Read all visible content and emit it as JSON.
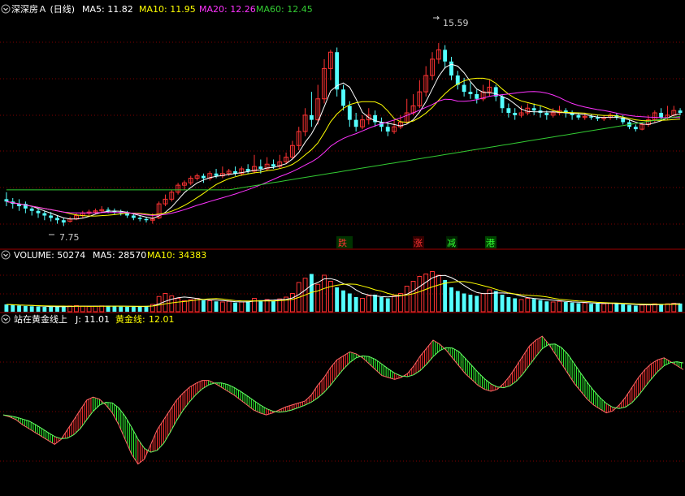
{
  "header": {
    "title": "深深房Ａ (日线)",
    "ma": [
      {
        "label": "MA5: 11.82",
        "color": "#ffffff"
      },
      {
        "label": "MA10: 11.95",
        "color": "#ffff00"
      },
      {
        "label": "MA20: 12.26",
        "color": "#ff33ff"
      },
      {
        "label": "MA60: 12.45",
        "color": "#33cc33"
      }
    ]
  },
  "volume_header": {
    "items": [
      {
        "label": "VOLUME: 50274",
        "color": "#ffffff"
      },
      {
        "label": "MA5: 28570",
        "color": "#ffffff"
      },
      {
        "label": "MA10: 34383",
        "color": "#ffff00"
      }
    ]
  },
  "indicator_header": {
    "items": [
      {
        "label": "站在黄金线上",
        "color": "#ffffff"
      },
      {
        "label": "J: 11.01",
        "color": "#ffffff"
      },
      {
        "label": "黄金线: ",
        "color": "#ffff00"
      },
      {
        "label": "12.01",
        "color": "#ffff00"
      }
    ]
  },
  "annotations": {
    "high_label": "15.59",
    "low_label": "7.75",
    "markers": [
      {
        "text": "跌",
        "color": "#ff3333"
      },
      {
        "text": "涨",
        "color": "#ff3333"
      },
      {
        "text": "减",
        "color": "#33ff33"
      },
      {
        "text": "港",
        "color": "#33ff33"
      }
    ]
  },
  "colors": {
    "up": "#ff3333",
    "down": "#54ffff",
    "ind_up": "#ff3333",
    "ind_down": "#33ff33",
    "grid": "#800000",
    "panel_border": "#a00000"
  },
  "chart_data": [
    {
      "type": "candlestick",
      "title": "深深房Ａ (日线)",
      "ylim": [
        7.0,
        16.6
      ],
      "high": 15.59,
      "low": 7.75,
      "moving_averages": [
        {
          "name": "MA5",
          "value": 11.82
        },
        {
          "name": "MA10",
          "value": 11.95
        },
        {
          "name": "MA20",
          "value": 12.26
        },
        {
          "name": "MA60",
          "value": 12.45
        }
      ],
      "candles": [
        [
          8.9,
          8.8,
          9.2,
          8.6
        ],
        [
          8.8,
          8.7,
          8.95,
          8.5
        ],
        [
          8.7,
          8.6,
          8.9,
          8.4
        ],
        [
          8.7,
          8.5,
          8.8,
          8.3
        ],
        [
          8.5,
          8.4,
          8.6,
          8.2
        ],
        [
          8.4,
          8.3,
          8.5,
          8.1
        ],
        [
          8.3,
          8.2,
          8.4,
          8.0
        ],
        [
          8.2,
          8.1,
          8.35,
          7.95
        ],
        [
          8.1,
          8.0,
          8.2,
          7.85
        ],
        [
          8.0,
          7.9,
          8.1,
          7.75
        ],
        [
          7.95,
          8.05,
          8.15,
          7.9
        ],
        [
          8.05,
          8.2,
          8.3,
          8.0
        ],
        [
          8.2,
          8.3,
          8.4,
          8.1
        ],
        [
          8.3,
          8.35,
          8.45,
          8.2
        ],
        [
          8.35,
          8.4,
          8.5,
          8.25
        ],
        [
          8.4,
          8.45,
          8.6,
          8.3
        ],
        [
          8.45,
          8.4,
          8.55,
          8.3
        ],
        [
          8.4,
          8.35,
          8.5,
          8.25
        ],
        [
          8.35,
          8.3,
          8.45,
          8.2
        ],
        [
          8.3,
          8.2,
          8.4,
          8.1
        ],
        [
          8.2,
          8.1,
          8.3,
          8.0
        ],
        [
          8.1,
          8.05,
          8.2,
          7.95
        ],
        [
          8.05,
          8.0,
          8.15,
          7.9
        ],
        [
          8.0,
          8.05,
          8.3,
          7.85
        ],
        [
          8.1,
          8.7,
          8.8,
          8.05
        ],
        [
          8.7,
          8.9,
          9.1,
          8.6
        ],
        [
          8.9,
          9.2,
          9.3,
          8.8
        ],
        [
          9.2,
          9.5,
          9.6,
          9.1
        ],
        [
          9.5,
          9.6,
          9.7,
          9.3
        ],
        [
          9.6,
          9.8,
          9.9,
          9.5
        ],
        [
          9.8,
          9.9,
          10.0,
          9.7
        ],
        [
          9.9,
          9.8,
          10.0,
          9.6
        ],
        [
          9.8,
          10.0,
          10.1,
          9.7
        ],
        [
          10.0,
          9.9,
          10.2,
          9.8
        ],
        [
          9.9,
          10.0,
          10.3,
          9.8
        ],
        [
          10.0,
          10.1,
          10.2,
          9.9
        ],
        [
          10.1,
          10.0,
          10.3,
          9.9
        ],
        [
          10.0,
          10.2,
          10.3,
          9.9
        ],
        [
          10.2,
          10.1,
          10.4,
          10.0
        ],
        [
          10.1,
          10.3,
          10.8,
          10.0
        ],
        [
          10.3,
          10.2,
          10.6,
          10.0
        ],
        [
          10.2,
          10.4,
          10.7,
          10.1
        ],
        [
          10.4,
          10.3,
          10.6,
          10.2
        ],
        [
          10.3,
          10.5,
          10.8,
          10.2
        ],
        [
          10.5,
          10.7,
          10.9,
          10.4
        ],
        [
          10.7,
          11.2,
          11.4,
          10.6
        ],
        [
          11.2,
          11.8,
          12.0,
          11.0
        ],
        [
          11.8,
          12.5,
          12.8,
          11.6
        ],
        [
          12.5,
          12.3,
          13.5,
          12.0
        ],
        [
          12.3,
          13.2,
          13.8,
          12.1
        ],
        [
          13.2,
          14.5,
          14.9,
          13.0
        ],
        [
          14.5,
          15.2,
          15.3,
          14.0
        ],
        [
          15.2,
          13.6,
          15.4,
          13.3
        ],
        [
          13.6,
          12.9,
          13.8,
          12.7
        ],
        [
          12.9,
          12.3,
          13.1,
          12.0
        ],
        [
          12.3,
          12.0,
          12.6,
          11.8
        ],
        [
          12.0,
          12.3,
          12.5,
          11.9
        ],
        [
          12.3,
          12.5,
          12.8,
          12.1
        ],
        [
          12.5,
          12.2,
          12.7,
          12.0
        ],
        [
          12.2,
          12.0,
          12.4,
          11.8
        ],
        [
          12.0,
          11.8,
          12.2,
          11.6
        ],
        [
          11.8,
          12.0,
          12.3,
          11.7
        ],
        [
          12.0,
          12.2,
          12.5,
          11.9
        ],
        [
          12.2,
          12.6,
          13.2,
          12.1
        ],
        [
          12.6,
          12.9,
          13.4,
          12.5
        ],
        [
          12.9,
          13.5,
          14.0,
          12.8
        ],
        [
          13.5,
          14.2,
          14.6,
          13.3
        ],
        [
          14.2,
          14.9,
          15.2,
          14.0
        ],
        [
          14.9,
          15.3,
          15.59,
          14.7
        ],
        [
          15.3,
          14.8,
          15.5,
          14.5
        ],
        [
          14.8,
          14.2,
          15.0,
          14.0
        ],
        [
          14.2,
          13.8,
          14.4,
          13.6
        ],
        [
          13.8,
          13.5,
          14.1,
          13.3
        ],
        [
          13.5,
          13.4,
          13.9,
          13.2
        ],
        [
          13.4,
          13.2,
          13.6,
          13.0
        ],
        [
          13.2,
          13.5,
          13.8,
          13.1
        ],
        [
          13.5,
          13.7,
          14.0,
          13.3
        ],
        [
          13.7,
          13.3,
          13.8,
          13.1
        ],
        [
          13.3,
          12.8,
          13.4,
          12.6
        ],
        [
          12.8,
          12.6,
          13.0,
          12.4
        ],
        [
          12.6,
          12.5,
          12.8,
          12.3
        ],
        [
          12.5,
          12.6,
          12.9,
          12.4
        ],
        [
          12.6,
          12.8,
          13.0,
          12.5
        ],
        [
          12.8,
          12.7,
          13.0,
          12.5
        ],
        [
          12.7,
          12.6,
          12.9,
          12.4
        ],
        [
          12.6,
          12.5,
          12.7,
          12.3
        ],
        [
          12.5,
          12.6,
          12.8,
          12.4
        ],
        [
          12.6,
          12.7,
          12.9,
          12.5
        ],
        [
          12.7,
          12.6,
          12.8,
          12.4
        ],
        [
          12.6,
          12.5,
          12.7,
          12.3
        ],
        [
          12.5,
          12.4,
          12.6,
          12.3
        ],
        [
          12.4,
          12.45,
          12.6,
          12.3
        ],
        [
          12.45,
          12.4,
          12.55,
          12.3
        ],
        [
          12.4,
          12.35,
          12.5,
          12.25
        ],
        [
          12.35,
          12.4,
          12.5,
          12.25
        ],
        [
          12.4,
          12.5,
          12.6,
          12.3
        ],
        [
          12.5,
          12.4,
          12.6,
          12.3
        ],
        [
          12.4,
          12.2,
          12.5,
          12.1
        ],
        [
          12.2,
          12.0,
          12.3,
          11.9
        ],
        [
          12.0,
          11.9,
          12.1,
          11.8
        ],
        [
          11.9,
          12.1,
          12.2,
          11.85
        ],
        [
          12.1,
          12.3,
          12.5,
          12.0
        ],
        [
          12.3,
          12.6,
          12.7,
          12.2
        ],
        [
          12.6,
          12.4,
          12.8,
          12.3
        ],
        [
          12.4,
          12.5,
          12.9,
          12.3
        ],
        [
          12.5,
          12.7,
          12.9,
          12.4
        ],
        [
          12.7,
          12.6,
          12.8,
          12.5
        ]
      ]
    },
    {
      "type": "bar",
      "title": "VOLUME",
      "value": 50274,
      "ma5": 28570,
      "ma10": 34383,
      "ylim": [
        0,
        80000
      ],
      "values": [
        12000,
        11000,
        10000,
        9500,
        9000,
        8500,
        8000,
        8000,
        8500,
        9000,
        9500,
        10000,
        9000,
        8500,
        9000,
        9500,
        10000,
        9000,
        8500,
        8000,
        8500,
        9000,
        9500,
        12000,
        25000,
        30000,
        26000,
        22000,
        18000,
        20000,
        22000,
        19000,
        18000,
        17000,
        16000,
        17000,
        15000,
        16000,
        17000,
        22000,
        19000,
        20000,
        18000,
        21000,
        24000,
        30000,
        48000,
        55000,
        62000,
        45000,
        60000,
        50000,
        40000,
        35000,
        30000,
        24000,
        22000,
        26000,
        28000,
        24000,
        22000,
        26000,
        30000,
        42000,
        50000,
        58000,
        62000,
        66000,
        60000,
        52000,
        40000,
        34000,
        30000,
        28000,
        26000,
        30000,
        36000,
        34000,
        28000,
        24000,
        22000,
        20000,
        22000,
        21000,
        19000,
        17000,
        16000,
        17000,
        16000,
        15000,
        14000,
        14500,
        13000,
        13500,
        13000,
        14000,
        13000,
        12000,
        11000,
        10000,
        11000,
        12000,
        13000,
        12500,
        13000,
        14000,
        13500
      ]
    },
    {
      "type": "bar",
      "title": "站在黄金线上",
      "J": 11.01,
      "golden_line": 12.01,
      "ylim": [
        -60,
        110
      ],
      "values": [
        20,
        18,
        15,
        10,
        6,
        2,
        -2,
        -6,
        -10,
        -5,
        5,
        15,
        25,
        35,
        38,
        36,
        30,
        22,
        10,
        -5,
        -20,
        -30,
        -25,
        -10,
        5,
        15,
        25,
        35,
        42,
        48,
        52,
        55,
        55,
        52,
        48,
        44,
        40,
        35,
        30,
        25,
        22,
        20,
        22,
        25,
        28,
        30,
        32,
        34,
        40,
        50,
        58,
        68,
        76,
        80,
        84,
        82,
        78,
        72,
        66,
        60,
        58,
        56,
        58,
        62,
        70,
        80,
        88,
        96,
        92,
        86,
        78,
        70,
        62,
        56,
        50,
        46,
        44,
        46,
        52,
        60,
        70,
        80,
        90,
        96,
        100,
        92,
        82,
        72,
        62,
        52,
        44,
        36,
        30,
        26,
        22,
        24,
        30,
        38,
        48,
        58,
        66,
        72,
        76,
        78,
        74,
        70,
        66
      ]
    }
  ]
}
